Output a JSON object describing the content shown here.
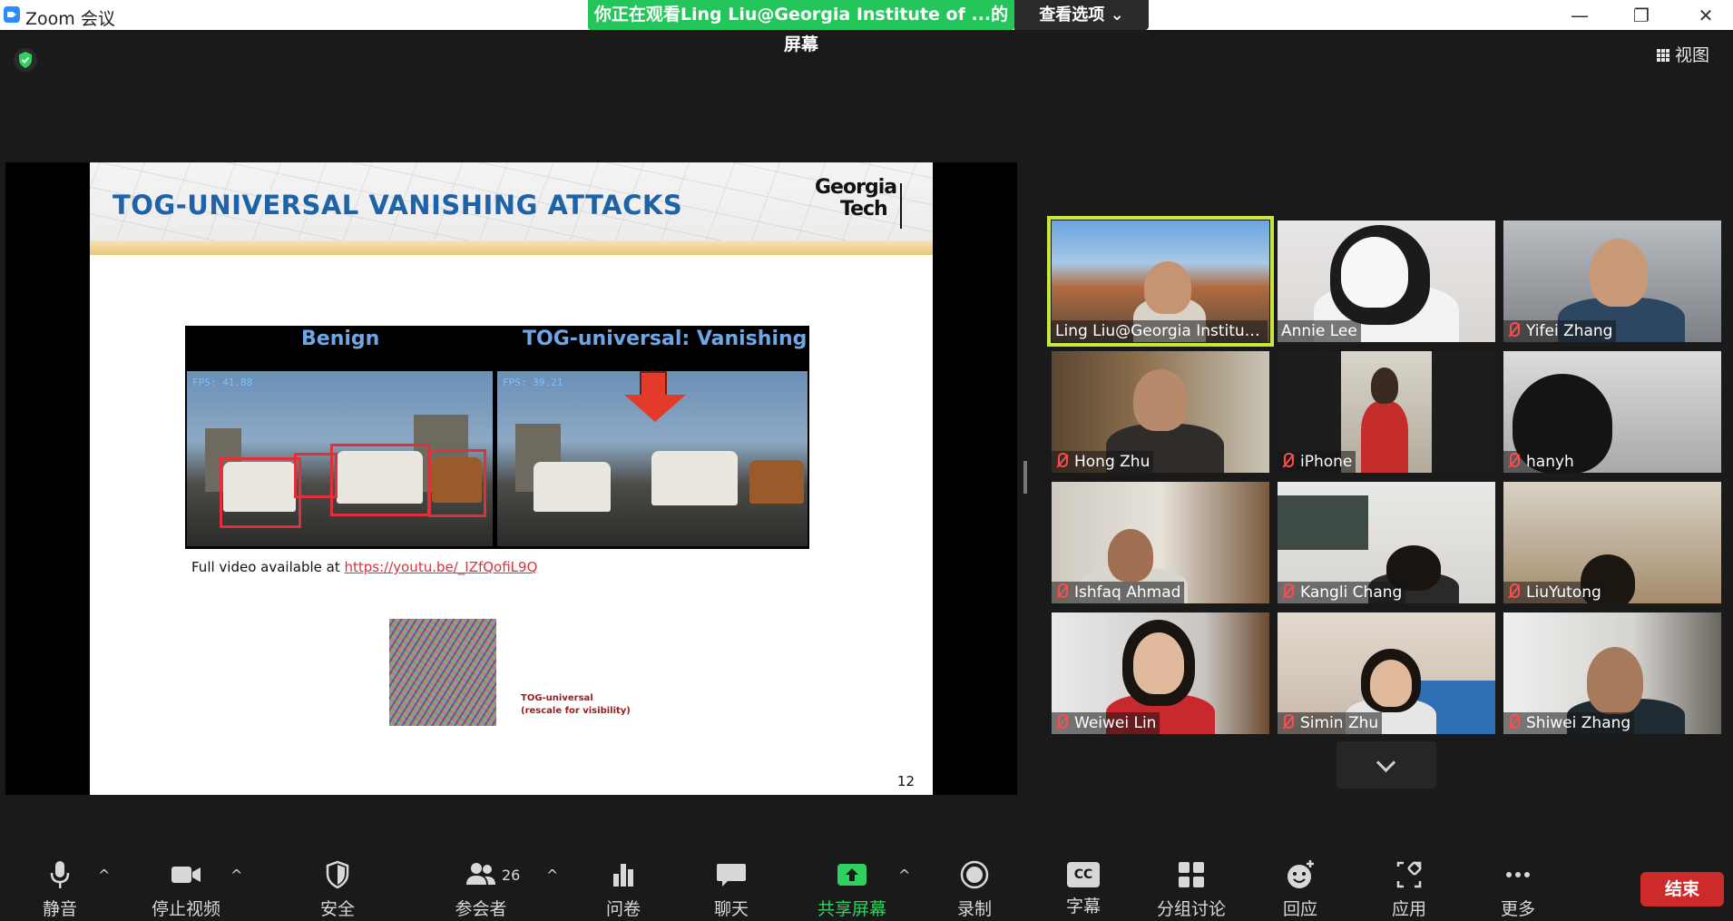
{
  "window": {
    "title": "Zoom 会议",
    "share_banner": "你正在观看Ling Liu@Georgia Institute of ...的屏幕",
    "view_options": "查看选项 ⌄",
    "minimize": "—",
    "restore": "❐",
    "close": "✕"
  },
  "meeting": {
    "gallery_view_label": "视图",
    "security_badge_color": "#2fd25f"
  },
  "slide": {
    "title": "TOG-UNIVERSAL VANISHING ATTACKS",
    "logo_line1": "Georgia",
    "logo_line2": "Tech",
    "video_label_left": "Benign",
    "video_label_right": "TOG-universal: Vanishing",
    "fps_left": "FPS: 41.88",
    "fps_right": "FPS: 39.21",
    "caption_prefix": "Full video available at ",
    "caption_link": "https://youtu.be/_IZfQofiL9Q",
    "noise_label_line1": "TOG-universal",
    "noise_label_line2": "(rescale for visibility)",
    "page_number": "12"
  },
  "participants": [
    {
      "name": "Ling Liu@Georgia Institut...",
      "muted": false,
      "active": true
    },
    {
      "name": "Annie Lee",
      "muted": false,
      "active": false
    },
    {
      "name": "Yifei Zhang",
      "muted": true,
      "active": false
    },
    {
      "name": "Hong Zhu",
      "muted": true,
      "active": false
    },
    {
      "name": "iPhone",
      "muted": true,
      "active": false
    },
    {
      "name": "hanyh",
      "muted": true,
      "active": false
    },
    {
      "name": "Ishfaq Ahmad",
      "muted": true,
      "active": false
    },
    {
      "name": "Kangli Chang",
      "muted": true,
      "active": false
    },
    {
      "name": "LiuYutong",
      "muted": true,
      "active": false
    },
    {
      "name": "Weiwei Lin",
      "muted": true,
      "active": false
    },
    {
      "name": "Simin Zhu",
      "muted": true,
      "active": false
    },
    {
      "name": "Shiwei Zhang",
      "muted": true,
      "active": false
    }
  ],
  "toolbar": {
    "mute": "静音",
    "stop_video": "停止视频",
    "security": "安全",
    "participants": "参会者",
    "participants_count": "26",
    "polls": "问卷",
    "chat": "聊天",
    "share_screen": "共享屏幕",
    "record": "录制",
    "captions": "字幕",
    "captions_icon_text": "CC",
    "breakout_rooms": "分组讨论",
    "reactions": "回应",
    "apps": "应用",
    "more": "更多",
    "end": "结束",
    "caret": "^"
  }
}
